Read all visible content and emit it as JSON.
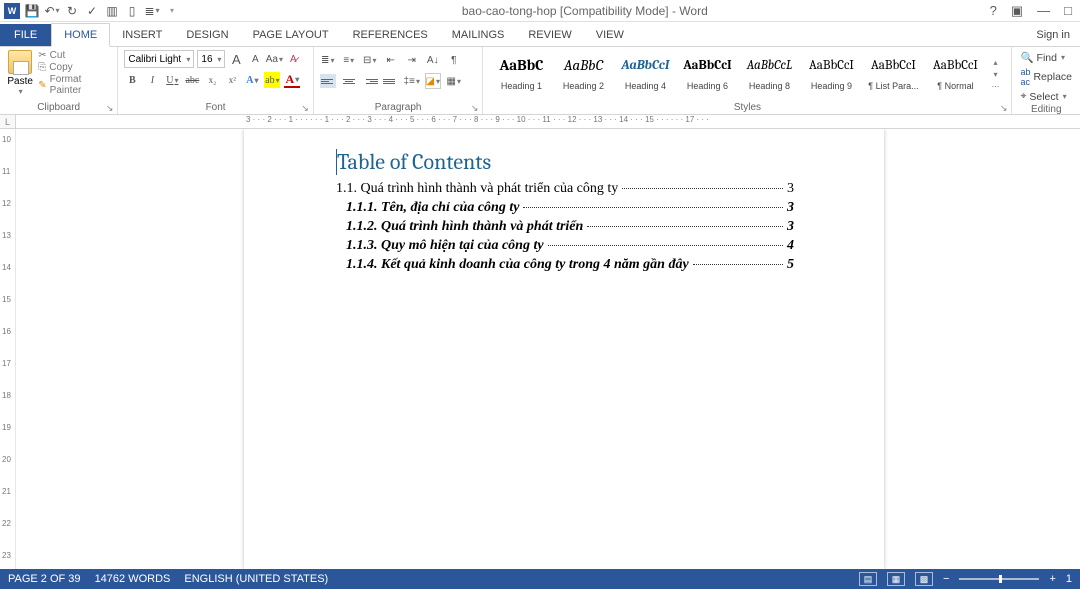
{
  "titlebar": {
    "title": "bao-cao-tong-hop [Compatibility Mode] - Word"
  },
  "tabs": {
    "file": "FILE",
    "items": [
      "HOME",
      "INSERT",
      "DESIGN",
      "PAGE LAYOUT",
      "REFERENCES",
      "MAILINGS",
      "REVIEW",
      "VIEW"
    ],
    "signin": "Sign in"
  },
  "clipboard": {
    "paste": "Paste",
    "cut": "Cut",
    "copy": "Copy",
    "format_painter": "Format Painter",
    "group_label": "Clipboard"
  },
  "font": {
    "name": "Calibri Light",
    "size": "16",
    "group_label": "Font"
  },
  "paragraph": {
    "group_label": "Paragraph"
  },
  "styles": {
    "group_label": "Styles",
    "items": [
      {
        "preview": "AaBbC",
        "label": "Heading 1",
        "css": "font-weight:bold;color:#222"
      },
      {
        "preview": "AaBbC",
        "label": "Heading 2",
        "css": "font-style:italic;color:#222"
      },
      {
        "preview": "AaBbCcI",
        "label": "Heading 4",
        "css": "font-style:italic;font-weight:bold;color:#1f6391"
      },
      {
        "preview": "AaBbCcI",
        "label": "Heading 6",
        "css": "font-weight:bold;color:#222"
      },
      {
        "preview": "AaBbCcL",
        "label": "Heading 8",
        "css": "font-style:italic;color:#444"
      },
      {
        "preview": "AaBbCcI",
        "label": "Heading 9",
        "css": "color:#222"
      },
      {
        "preview": "AaBbCcI",
        "label": "¶ List Para...",
        "css": "color:#222"
      },
      {
        "preview": "AaBbCcI",
        "label": "¶ Normal",
        "css": "color:#222"
      }
    ]
  },
  "editing": {
    "find": "Find",
    "replace": "Replace",
    "select": "Select",
    "group_label": "Editing"
  },
  "ruler_h": "3 · · · 2 · · · 1 · · ·   · · · 1 · · · 2 · · · 3 · · · 4 · · · 5 · · · 6 · · · 7 · · · 8 · · · 9 · · · 10 · · · 11 · · · 12 · · · 13 · · · 14 · · · 15 · · ·   · · · 17 · · ·",
  "ruler_v": [
    "10",
    "11",
    "12",
    "13",
    "14",
    "15",
    "16",
    "17",
    "18",
    "19",
    "20",
    "21",
    "22",
    "23"
  ],
  "document": {
    "toc_title": "Table of Contents",
    "entries": [
      {
        "text": "1.1. Quá trình hình thành và phát triển của công ty",
        "page": "3",
        "indent": false
      },
      {
        "text": "1.1.1. Tên, địa chỉ của công ty",
        "page": "3",
        "indent": true
      },
      {
        "text": "1.1.2. Quá trình hình thành và phát triển",
        "page": "3",
        "indent": true
      },
      {
        "text": "1.1.3. Quy mô hiện tại của công ty",
        "page": "4",
        "indent": true
      },
      {
        "text": "1.1.4. Kết quả kinh doanh của công ty trong 4 năm gần đây",
        "page": "5",
        "indent": true
      }
    ]
  },
  "status": {
    "page": "PAGE 2 OF 39",
    "words": "14762 WORDS",
    "lang": "ENGLISH (UNITED STATES)",
    "zoom": "1"
  }
}
